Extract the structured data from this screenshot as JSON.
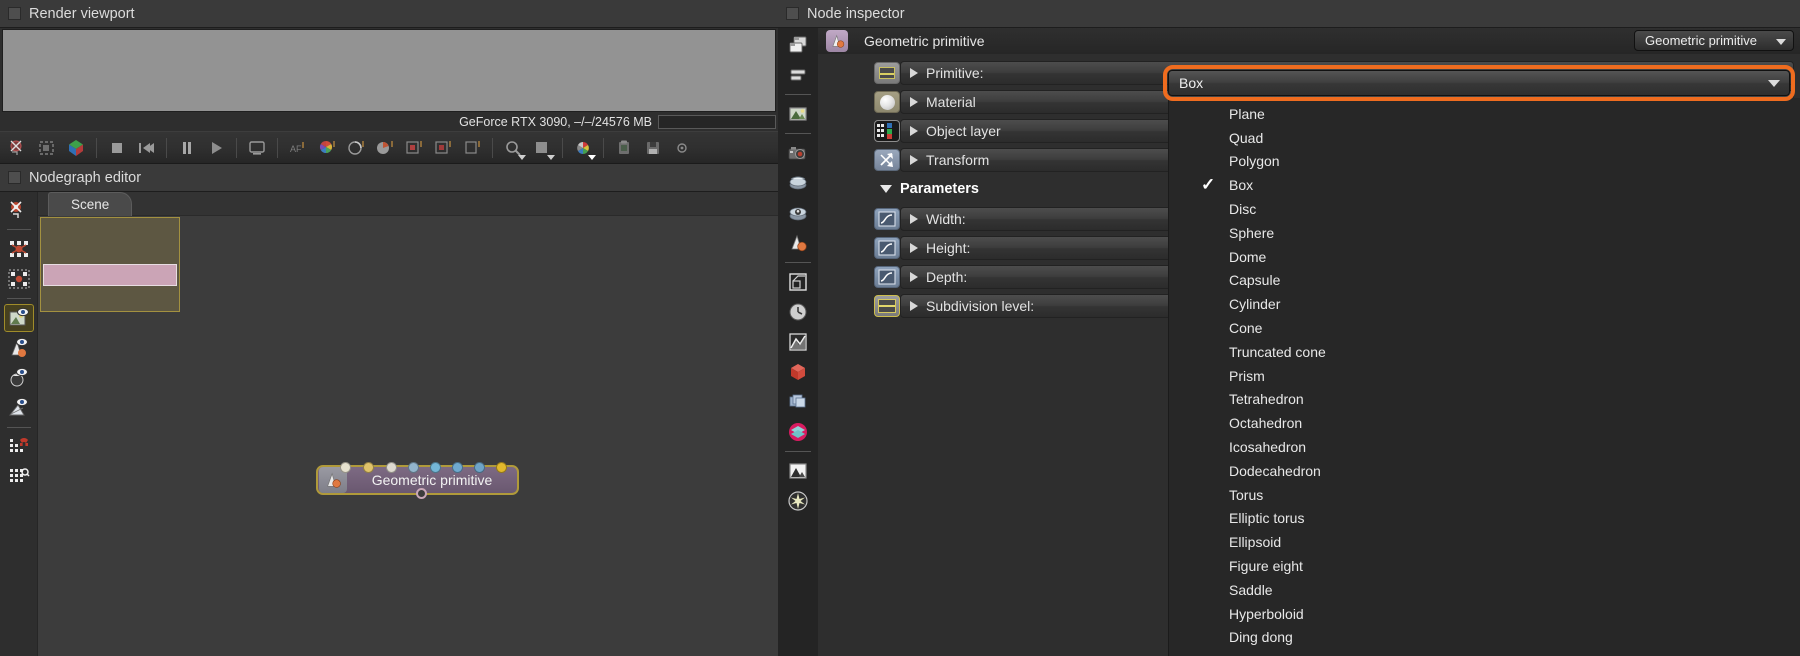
{
  "render_viewport": {
    "title": "Render viewport",
    "gpu_status": "GeForce RTX 3090, –/–/24576 MB",
    "toolbar_icons": [
      "render-region-icon",
      "render-selection-icon",
      "render-scene-icon",
      "stop-icon",
      "rewind-icon",
      "pause-icon",
      "play-icon",
      "screen-icon",
      "af-icon",
      "color-wheel-icon",
      "aperture-icon",
      "histogram-icon",
      "region-red-icon",
      "region-square-icon",
      "region-copy-icon",
      "magnifier-icon",
      "frame-icon",
      "color-picker-icon",
      "clipboard-icon",
      "save-icon",
      "options-icon"
    ]
  },
  "nodegraph": {
    "title": "Nodegraph editor",
    "tab_label": "Scene",
    "sidebar_icons": [
      "node-delete-icon",
      "select-all-nodes-icon",
      "select-nodes-icon",
      "show-image-icon",
      "show-material-icon",
      "show-object-icon",
      "show-geometry-icon",
      "magnet-snap-icon",
      "grid-icon"
    ],
    "selected_sidebar_index": 3,
    "node": {
      "label": "Geometric primitive",
      "icon": "geometric-primitive-icon",
      "input_port_colors": [
        "#e7e2cf",
        "#e0c36a",
        "#dedad0",
        "#92b4cc",
        "#74b6d6",
        "#6fa9cf",
        "#6ea4c8",
        "#e2b92c"
      ],
      "output_port_color": "#caa8b8",
      "border_color": "#b09a3a"
    }
  },
  "node_inspector": {
    "title": "Node inspector",
    "header_label": "Geometric primitive",
    "header_icon": "geometric-primitive-icon",
    "header_select_value": "Geometric primitive",
    "sidebar_icons": [
      "copy-node-icon",
      "stack-node-icon",
      "image-icon",
      "camera-icon",
      "environment-icon",
      "render-layer-icon",
      "geometric-primitive-icon",
      "bounding-box-icon",
      "time-icon",
      "graph-icon",
      "red-cube-icon",
      "blue-cubes-icon",
      "layer-stack-icon",
      "picture-icon",
      "light-icon"
    ],
    "parameters_section_label": "Parameters",
    "rows": [
      {
        "label": "Primitive:",
        "icon": "primitive-chip-icon",
        "chip": "prim"
      },
      {
        "label": "Material",
        "icon": "material-sphere-icon",
        "chip": "mat"
      },
      {
        "label": "Object layer",
        "icon": "object-layer-icon",
        "chip": "layer"
      },
      {
        "label": "Transform",
        "icon": "transform-icon",
        "chip": "xform"
      }
    ],
    "param_rows": [
      {
        "label": "Width:",
        "icon": "curve-icon",
        "chip": "curve"
      },
      {
        "label": "Height:",
        "icon": "curve-icon",
        "chip": "curve"
      },
      {
        "label": "Depth:",
        "icon": "curve-icon",
        "chip": "curve"
      },
      {
        "label": "Subdivision level:",
        "icon": "integer-chip-icon",
        "chip": "yellow"
      }
    ]
  },
  "primitive_dropdown": {
    "value": "Box",
    "selected": "Box",
    "highlight_color": "#ef6c1f",
    "options": [
      "Plane",
      "Quad",
      "Polygon",
      "Box",
      "Disc",
      "Sphere",
      "Dome",
      "Capsule",
      "Cylinder",
      "Cone",
      "Truncated cone",
      "Prism",
      "Tetrahedron",
      "Octahedron",
      "Icosahedron",
      "Dodecahedron",
      "Torus",
      "Elliptic torus",
      "Ellipsoid",
      "Figure eight",
      "Saddle",
      "Hyperboloid",
      "Ding dong"
    ],
    "check_glyph": "✓"
  }
}
